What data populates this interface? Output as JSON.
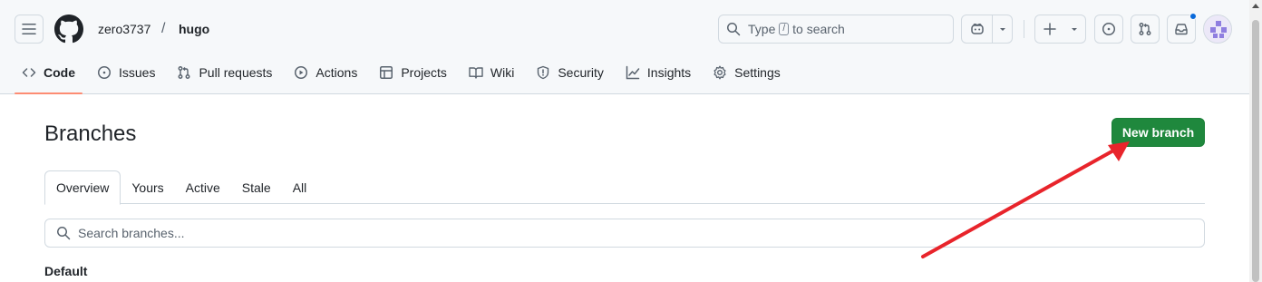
{
  "header": {
    "owner": "zero3737",
    "separator": "/",
    "repo": "hugo",
    "search": {
      "prefix": "Type",
      "key": "/",
      "suffix": "to search"
    }
  },
  "nav": {
    "code": "Code",
    "issues": "Issues",
    "pull_requests": "Pull requests",
    "actions": "Actions",
    "projects": "Projects",
    "wiki": "Wiki",
    "security": "Security",
    "insights": "Insights",
    "settings": "Settings"
  },
  "page": {
    "title": "Branches",
    "new_branch_label": "New branch",
    "tabs": {
      "overview": "Overview",
      "yours": "Yours",
      "active": "Active",
      "stale": "Stale",
      "all": "All"
    },
    "search_placeholder": "Search branches...",
    "section_label": "Default"
  },
  "colors": {
    "primary_button": "#1f883d",
    "active_tab_underline": "#fd8c73",
    "notification_dot": "#0969da",
    "annotation_arrow": "#e8242b"
  },
  "icons": [
    "hamburger-icon",
    "github-logo-icon",
    "search-icon",
    "copilot-icon",
    "chevron-down-icon",
    "plus-icon",
    "issue-opened-icon",
    "git-pull-request-icon",
    "inbox-icon",
    "code-icon",
    "play-icon",
    "table-icon",
    "book-icon",
    "shield-icon",
    "graph-icon",
    "gear-icon"
  ]
}
